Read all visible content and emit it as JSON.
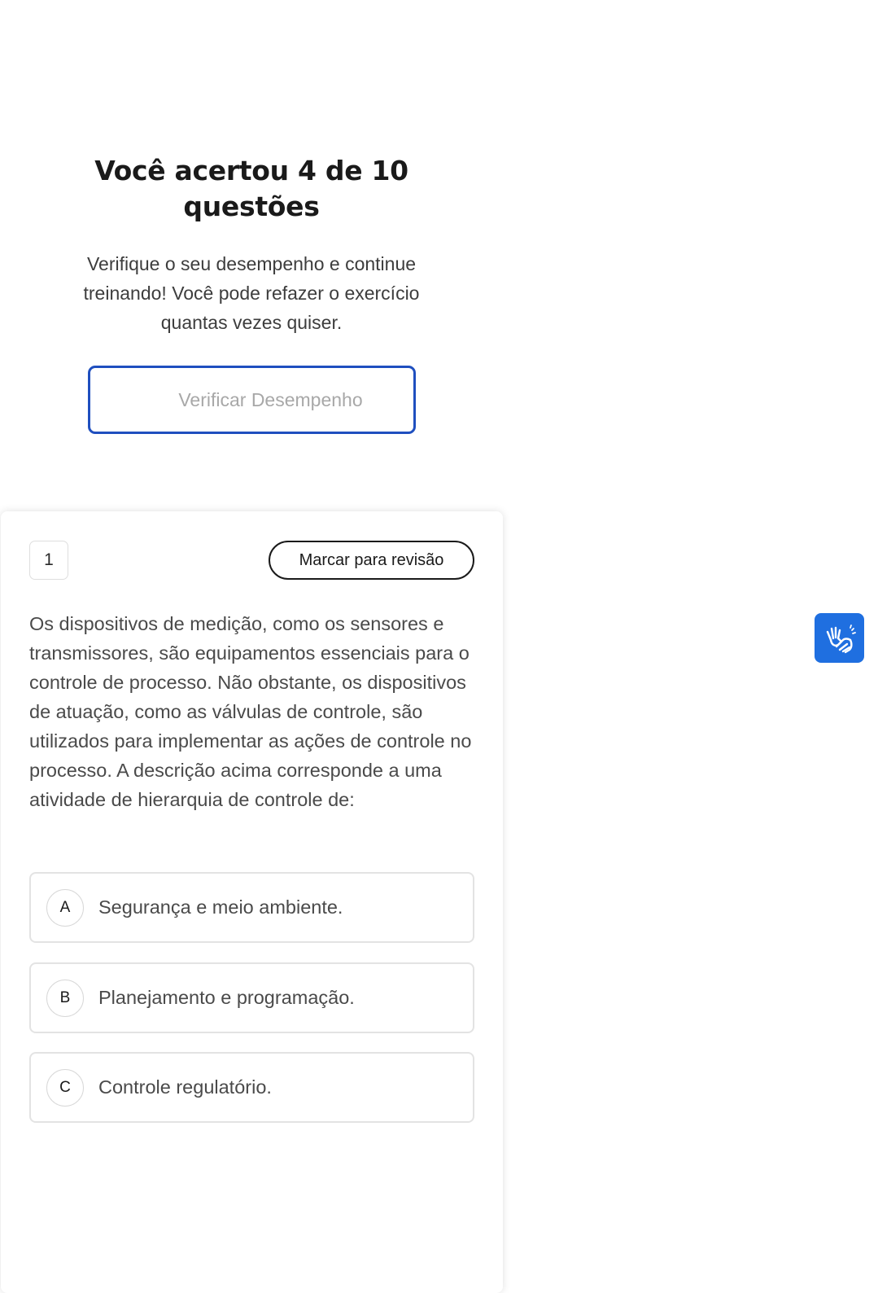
{
  "result": {
    "title": "Você acertou 4 de 10 questões",
    "subtitle": "Verifique o seu desempenho e continue treinando! Você pode refazer o exercício quantas vezes quiser.",
    "verify_button_label": "Verificar Desempenho"
  },
  "question": {
    "number": "1",
    "review_button_label": "Marcar para revisão",
    "text": "Os dispositivos de medição, como os sensores e transmissores, são equipamentos essenciais para o controle de processo. Não obstante, os dispositivos de atuação, como as válvulas de controle, são utilizados para implementar as ações de controle no processo. A descrição acima corresponde a uma atividade de hierarquia de controle de:",
    "options": [
      {
        "letter": "A",
        "text": "Segurança e meio ambiente."
      },
      {
        "letter": "B",
        "text": "Planejamento e programação."
      },
      {
        "letter": "C",
        "text": "Controle regulatório."
      }
    ]
  },
  "accessibility": {
    "icon": "sign-language-icon",
    "accent": "#1f6fe0"
  },
  "colors": {
    "button_border": "#1f4fbf"
  }
}
